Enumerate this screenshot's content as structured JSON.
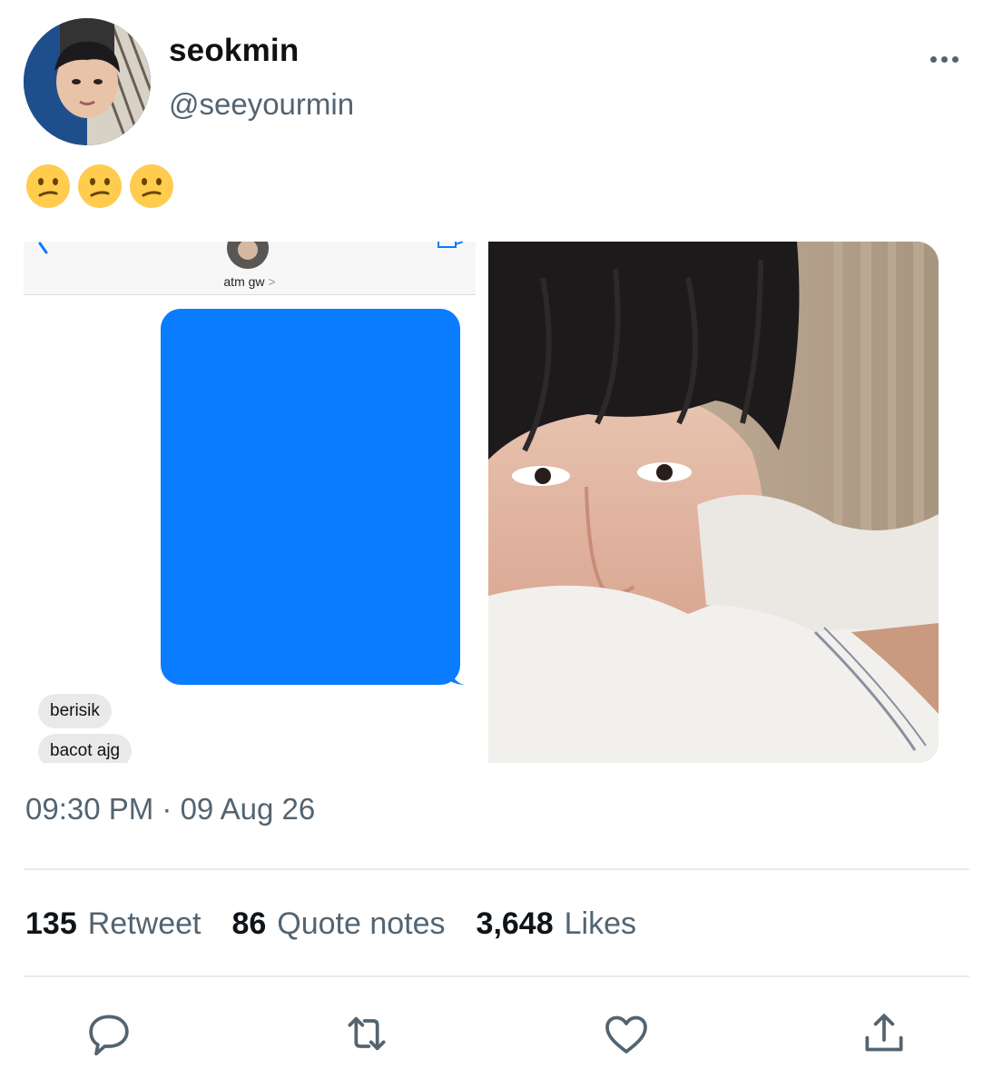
{
  "user": {
    "display_name": "seokmin",
    "handle": "@seeyourmin"
  },
  "tweet": {
    "emoji_text": "😕😕😕",
    "timestamp": "09:30 PM · 09 Aug 26"
  },
  "screenshot": {
    "contact_name": "atm gw",
    "incoming_messages": [
      "berisik",
      "bacot ajg"
    ]
  },
  "stats": {
    "retweets": {
      "count": "135",
      "label": "Retweet"
    },
    "quotes": {
      "count": "86",
      "label": "Quote notes"
    },
    "likes": {
      "count": "3,648",
      "label": "Likes"
    }
  },
  "actions": [
    "reply-icon",
    "retweet-icon",
    "like-icon",
    "share-icon"
  ],
  "colors": {
    "text_primary": "#0f1419",
    "text_secondary": "#536471",
    "imessage_blue": "#0a7cff",
    "divider": "#e6ecf0"
  }
}
